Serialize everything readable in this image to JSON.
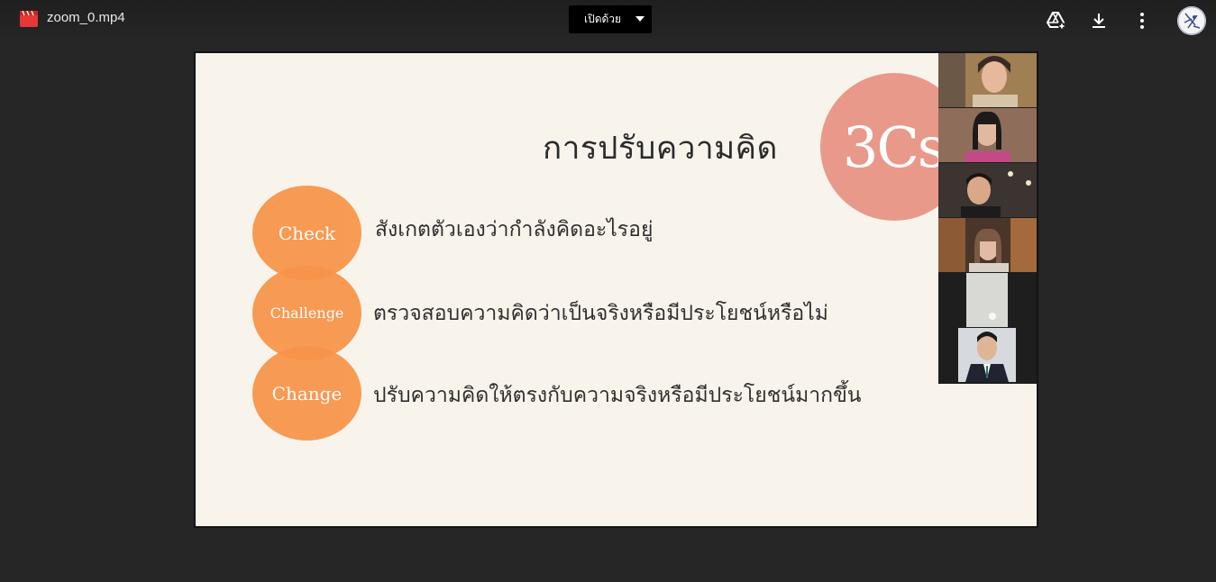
{
  "toolbar": {
    "file_name": "zoom_0.mp4",
    "open_with_label": "เปิดด้วย",
    "icons": [
      "video-file-icon",
      "add-to-drive-icon",
      "download-icon",
      "more-options-icon"
    ]
  },
  "slide": {
    "title": "การปรับความคิด",
    "badge": "3Cs",
    "steps": [
      {
        "label": "Check",
        "text": "สังเกตตัวเองว่ากำลังคิดอะไรอยู่"
      },
      {
        "label": "Challenge",
        "text": "ตรวจสอบความคิดว่าเป็นจริงหรือมีประโยชน์หรือไม่"
      },
      {
        "label": "Change",
        "text": "ปรับความคิดให้ตรงกับความจริงหรือมีประโยชน์มากขึ้น"
      }
    ]
  },
  "participants_count": 6,
  "colors": {
    "accent_orange": "#f79449",
    "badge_pink": "#e9998a",
    "slide_bg": "#f8f4ec",
    "viewer_bg": "#262626"
  }
}
